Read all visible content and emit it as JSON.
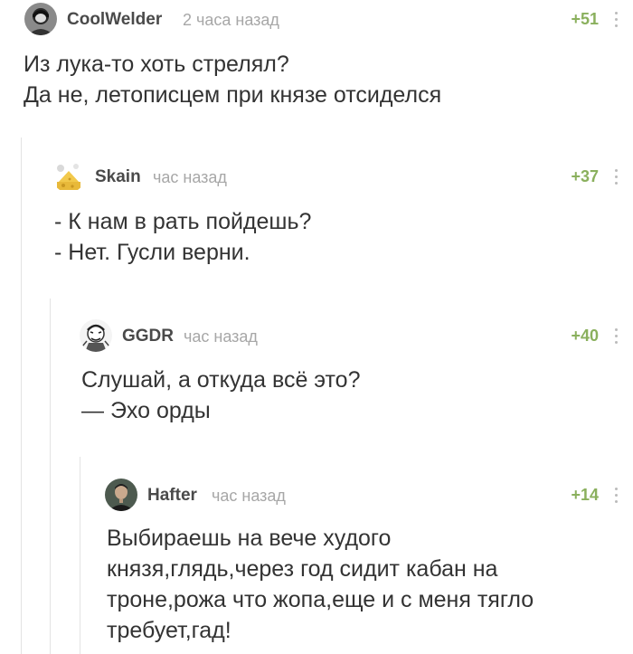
{
  "comments": [
    {
      "username": "CoolWelder",
      "time": "2 часа назад",
      "rating": "+51",
      "avatar_icon": "avatar-person-icon",
      "text": "Из лука-то хоть стрелял?\nДа не, летописцем при князе отсиделся"
    },
    {
      "username": "Skain",
      "time": "час назад",
      "rating": "+37",
      "avatar_icon": "avatar-cheese-icon",
      "text": "- К нам в рать пойдешь?\n- Нет. Гусли верни."
    },
    {
      "username": "GGDR",
      "time": "час назад",
      "rating": "+40",
      "avatar_icon": "avatar-sketch-icon",
      "text": "Слушай, а откуда всё это?\n— Эхо орды"
    },
    {
      "username": "Hafter",
      "time": "час назад",
      "rating": "+14",
      "avatar_icon": "avatar-portrait-icon",
      "text": "Выбираешь на вече худого\nкнязя,глядь,через год сидит кабан на\nтроне,рожа что жопа,еще и с меня тягло\nтребует,гад!"
    }
  ],
  "colors": {
    "rating": "#8ab05d",
    "username": "#4a4a4a",
    "time": "#a7a7a7",
    "text": "#333333",
    "thread_line": "#e3e3e3"
  }
}
